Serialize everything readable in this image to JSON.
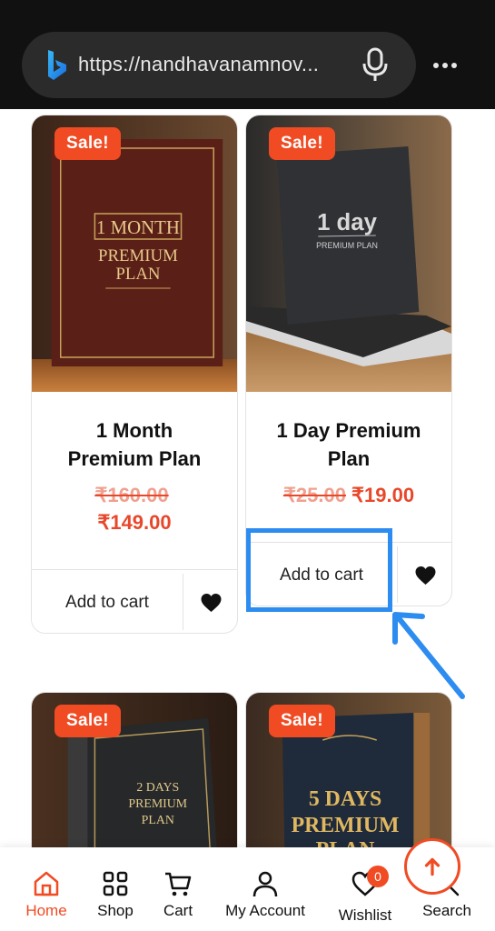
{
  "browser": {
    "url": "https://nandhavanamnov...",
    "logo_icon": "bing-icon",
    "mic_icon": "mic-icon",
    "menu_icon": "more-dots-icon"
  },
  "products": [
    {
      "sale": "Sale!",
      "title_line1": "1 Month",
      "title_line2": "Premium Plan",
      "old_price": "₹160.00",
      "new_price": "₹149.00",
      "cart_label": "Add to cart",
      "wishlist_icon": "heart-icon",
      "cover_line1": "1 MONTH",
      "cover_line2": "PREMIUM",
      "cover_line3": "PLAN"
    },
    {
      "sale": "Sale!",
      "title_line1": "1 Day Premium",
      "title_line2": "Plan",
      "old_price": "₹25.00",
      "new_price": "₹19.00",
      "cart_label": "Add to cart",
      "wishlist_icon": "heart-icon",
      "cover_line1": "1 day",
      "cover_line2": "PREMIUM PLAN"
    },
    {
      "sale": "Sale!",
      "cover_line1": "2 DAYS",
      "cover_line2": "PREMIUM",
      "cover_line3": "PLAN"
    },
    {
      "sale": "Sale!",
      "cover_line1": "5 DAYS",
      "cover_line2": "PREMIUM",
      "cover_line3": "PLAN"
    }
  ],
  "bottom_nav": {
    "items": [
      {
        "label": "Home",
        "icon": "home-icon",
        "active": true
      },
      {
        "label": "Shop",
        "icon": "grid-icon"
      },
      {
        "label": "Cart",
        "icon": "cart-icon"
      },
      {
        "label": "My Account",
        "icon": "user-icon"
      },
      {
        "label": "Wishlist",
        "icon": "heart-outline-icon",
        "badge": "0"
      },
      {
        "label": "Search",
        "icon": "search-icon"
      }
    ],
    "scroll_top_icon": "arrow-up-icon"
  },
  "colors": {
    "accent": "#f04b23",
    "price": "#e8472a",
    "annotation": "#2d8cf0"
  }
}
